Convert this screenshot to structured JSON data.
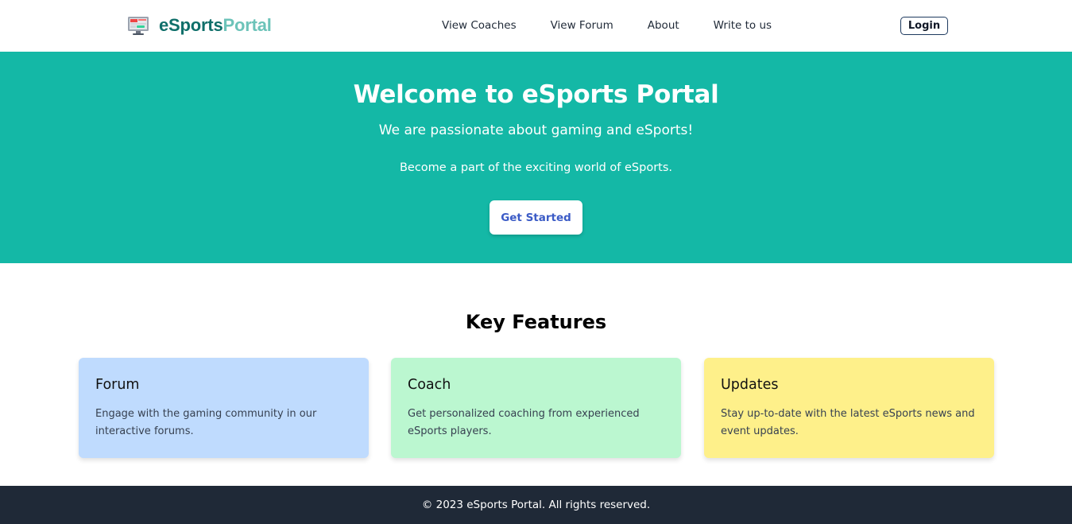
{
  "header": {
    "brand_part1": "eSports",
    "brand_part2": "Portal",
    "logo_icon": "monitor-icon",
    "nav": [
      {
        "label": "View Coaches"
      },
      {
        "label": "View Forum"
      },
      {
        "label": "About"
      },
      {
        "label": "Write to us"
      }
    ],
    "login_label": "Login"
  },
  "hero": {
    "title": "Welcome to eSports Portal",
    "tagline": "We are passionate about gaming and eSports!",
    "subtitle": "Become a part of the exciting world of eSports.",
    "cta_label": "Get Started",
    "background_color": "#14b8a6"
  },
  "features": {
    "title": "Key Features",
    "cards": [
      {
        "title": "Forum",
        "description": "Engage with the gaming community in our interactive forums.",
        "color": "#bfdbfe"
      },
      {
        "title": "Coach",
        "description": "Get personalized coaching from experienced eSports players.",
        "color": "#bbf7d0"
      },
      {
        "title": "Updates",
        "description": "Stay up-to-date with the latest eSports news and event updates.",
        "color": "#fef08a"
      }
    ]
  },
  "footer": {
    "text": "© 2023 eSports Portal. All rights reserved.",
    "background_color": "#1f2937"
  }
}
